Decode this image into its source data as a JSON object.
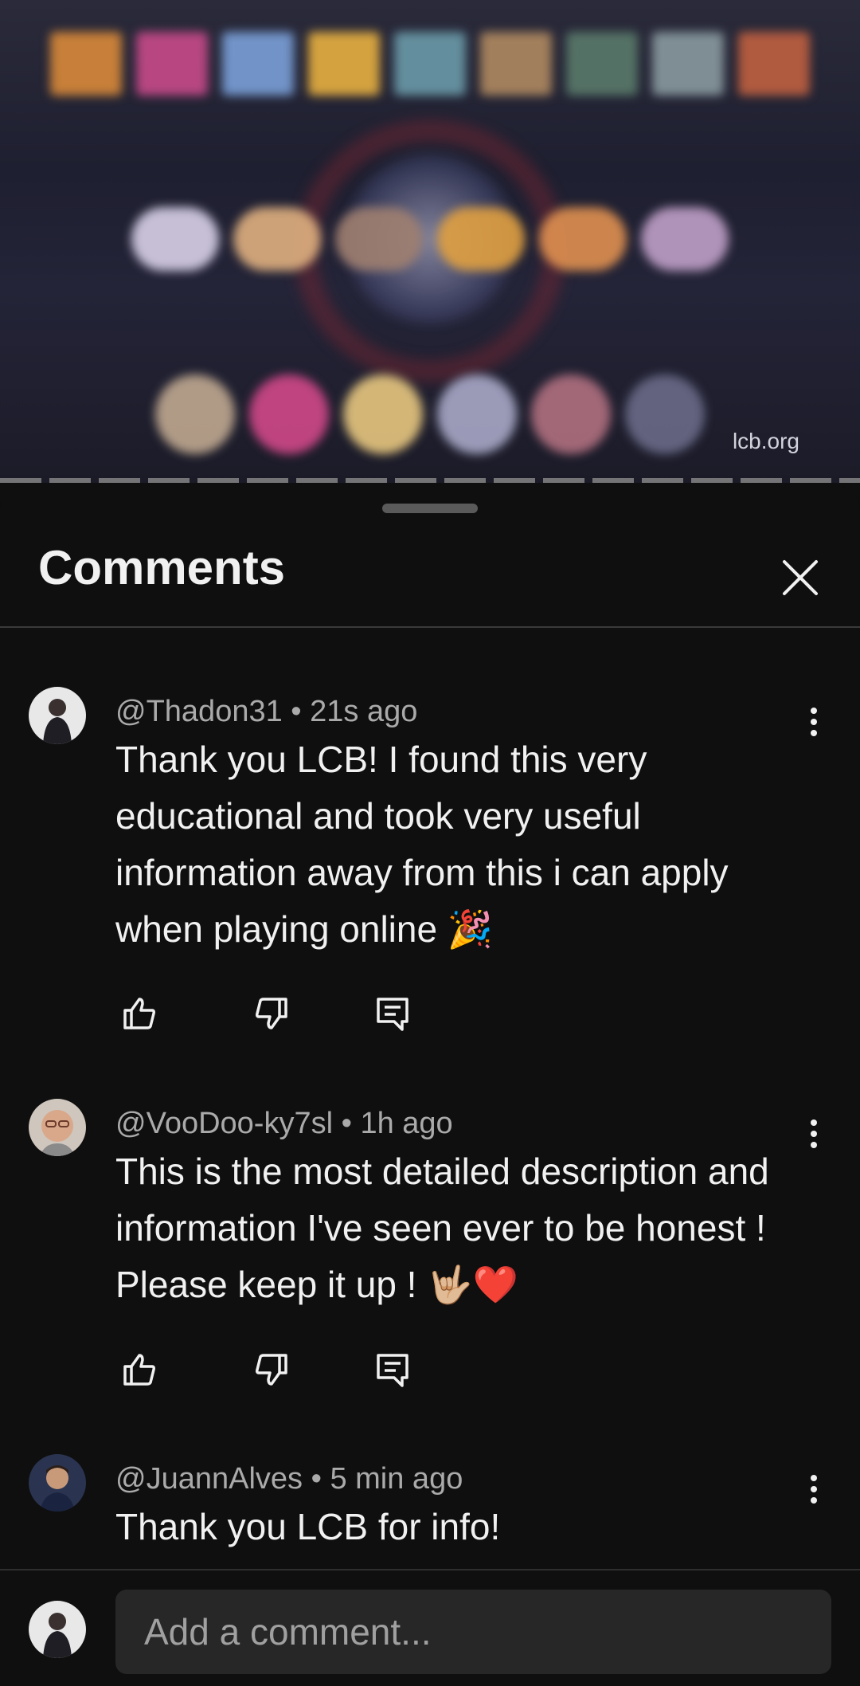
{
  "video": {
    "watermark": "lcb.org"
  },
  "sheet": {
    "title": "Comments",
    "close_icon": "close-icon"
  },
  "comments": [
    {
      "author": "@Thadon31",
      "age": "21s ago",
      "meta": "@Thadon31 • 21s ago",
      "text": "Thank you LCB! I found this very educational and took very useful information away from this i can apply when playing online 🎉"
    },
    {
      "author": "@VooDoo-ky7sl",
      "age": "1h ago",
      "meta": "@VooDoo-ky7sl • 1h ago",
      "text": "This is the most detailed description and information I've seen ever to be honest ! Please keep it up ! 🤟🏼❤️"
    },
    {
      "author": "@JuannAlves",
      "age": "5 min ago",
      "meta": "@JuannAlves • 5 min ago",
      "text": "Thank you LCB for info!"
    }
  ],
  "composer": {
    "placeholder": "Add a comment..."
  },
  "icons": {
    "like": "thumbs-up-icon",
    "dislike": "thumbs-down-icon",
    "reply": "reply-icon",
    "more": "more-vert-icon"
  }
}
